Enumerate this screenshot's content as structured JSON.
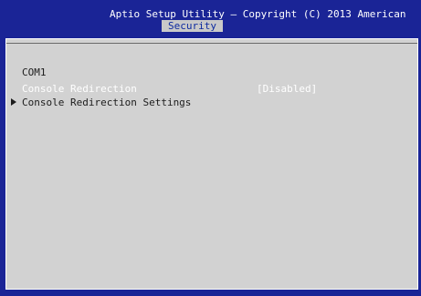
{
  "header": {
    "title": "Aptio Setup Utility – Copyright (C) 2013 American"
  },
  "tabs": [
    {
      "label": "Security",
      "active": true
    }
  ],
  "panel": {
    "section_label": "COM1",
    "items": [
      {
        "label": "Console Redirection",
        "value": "[Disabled]"
      },
      {
        "label": "Console Redirection Settings",
        "submenu": true
      }
    ]
  },
  "colors": {
    "background": "#1a2496",
    "panel": "#d2d2d2",
    "tab_active_bg": "#c9c9c9",
    "tab_active_text": "#0d2aa0",
    "highlight_text": "#ffffff"
  }
}
